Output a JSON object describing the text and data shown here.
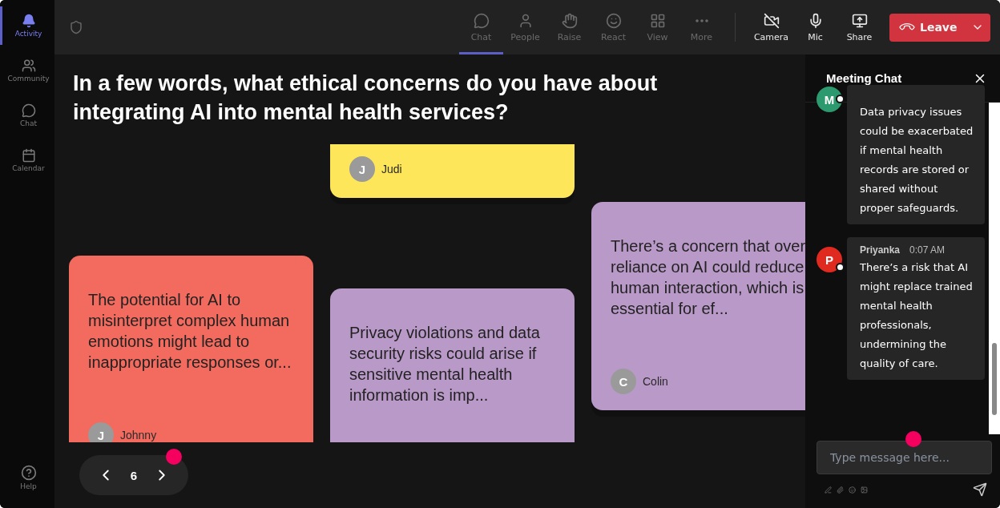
{
  "rail": {
    "items": [
      {
        "label": "Activity",
        "selected": true
      },
      {
        "label": "Community",
        "selected": false
      },
      {
        "label": "Chat",
        "selected": false
      },
      {
        "label": "Calendar",
        "selected": false
      }
    ],
    "help": "Help"
  },
  "toolbar": {
    "items": [
      {
        "label": "Chat",
        "selected": true
      },
      {
        "label": "People",
        "selected": false
      },
      {
        "label": "Raise",
        "selected": false
      },
      {
        "label": "React",
        "selected": false
      },
      {
        "label": "View",
        "selected": false
      },
      {
        "label": "More",
        "selected": false
      }
    ],
    "devices": [
      "Camera",
      "Mic",
      "Share"
    ],
    "leave": "Leave"
  },
  "question": "In a few words, what ethical concerns do you have about integrating AI into mental health services?",
  "notes": [
    {
      "initial": "J",
      "author": "Judi",
      "color": "#fde65a"
    },
    {
      "text": "The potential for AI to misinterpret complex human emotions might lead to inappropriate responses or...",
      "initial": "J",
      "author": "Johnny",
      "color": "#f26b5e"
    },
    {
      "text": "Privacy violations and data security risks could arise if sensitive mental health information is imp...",
      "color": "#b999c8"
    },
    {
      "text": "There’s a concern that over reliance on AI could reduce human interaction, which is essential for ef...",
      "initial": "C",
      "author": "Colin",
      "color": "#b999c8"
    }
  ],
  "pager": {
    "page": "6"
  },
  "chat": {
    "title": "Meeting Chat",
    "messages": [
      {
        "initial": "M",
        "color": "#2c9a6e",
        "text": "Data privacy issues could be exacerbated if mental health records are stored or shared without proper safeguards."
      },
      {
        "initial": "P",
        "color": "#e02a20",
        "author": "Priyanka",
        "time": "0:07 AM",
        "text": "There’s a risk that AI might replace trained mental health professionals, undermining the quality of care."
      }
    ],
    "composer": {
      "placeholder": "Type message here..."
    }
  }
}
